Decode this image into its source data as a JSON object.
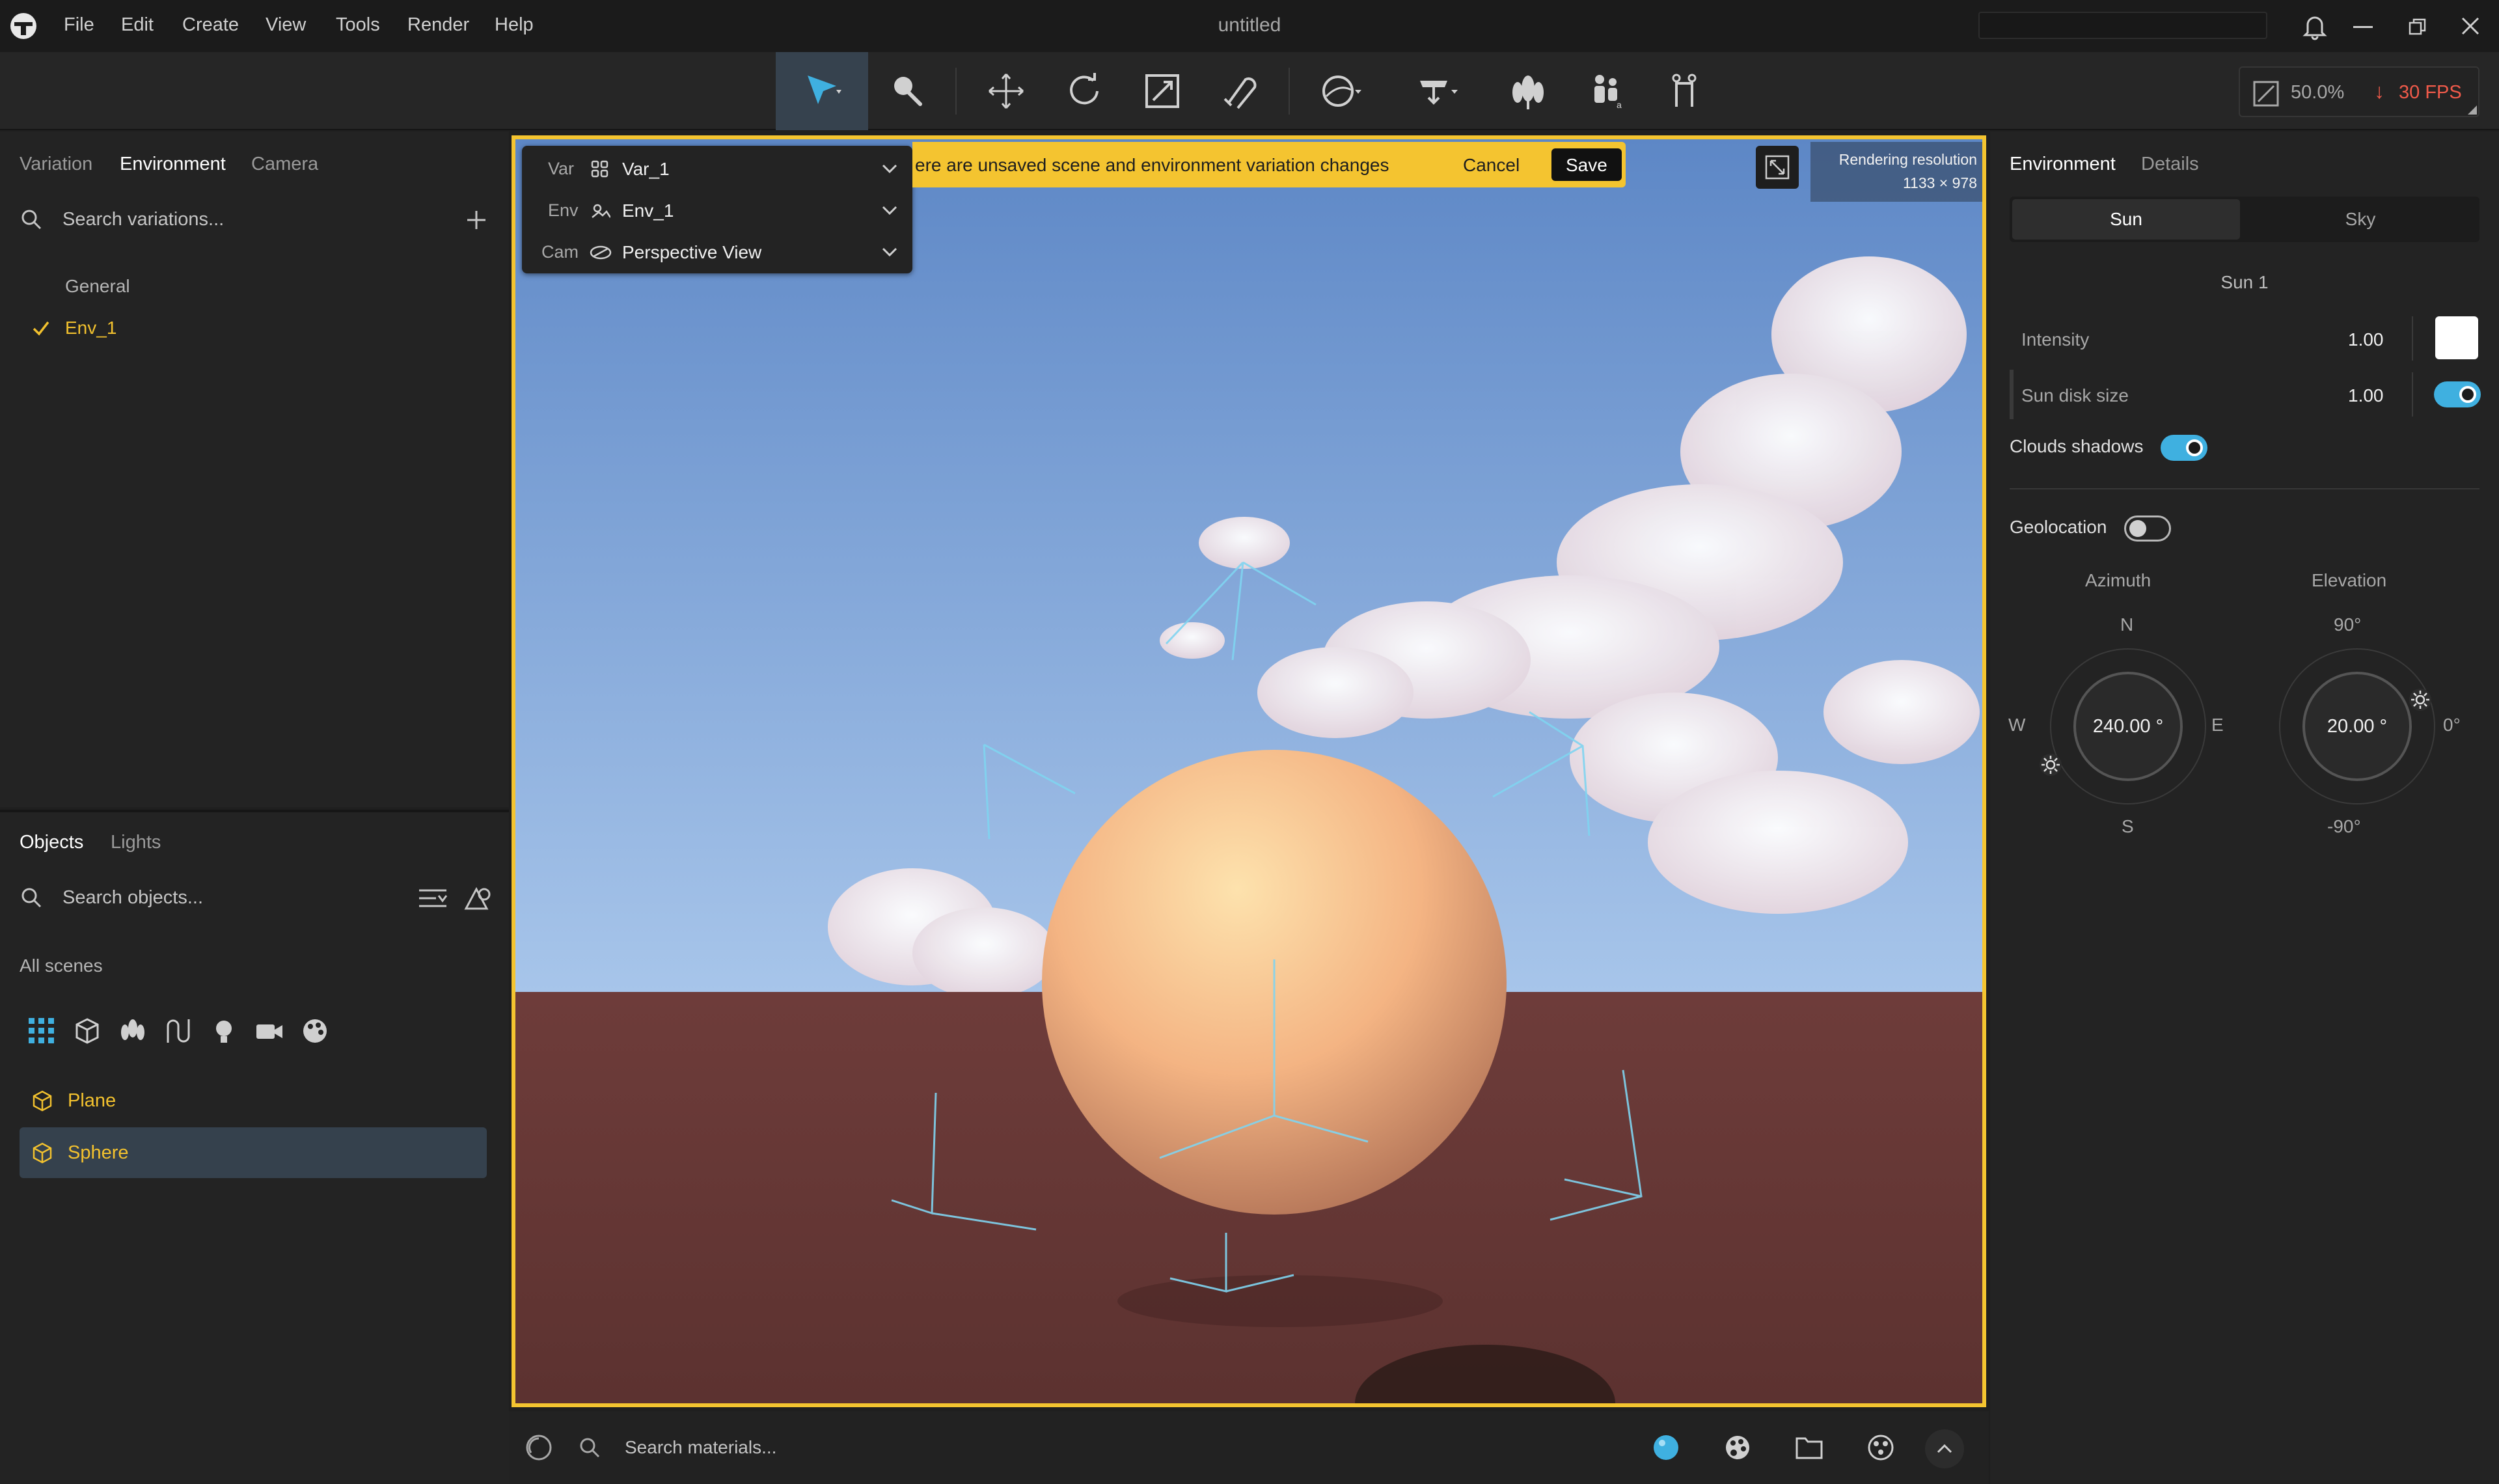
{
  "app": {
    "title": "untitled",
    "menu": [
      "File",
      "Edit",
      "Create",
      "View",
      "Tools",
      "Render",
      "Help"
    ]
  },
  "toolbar": {
    "zoom": "50.0%",
    "fps": "30 FPS",
    "tools": [
      "select-icon",
      "paint-icon",
      "move-icon",
      "rotate-icon",
      "scale-icon",
      "snap-icon",
      "shape-icon",
      "stage-icon",
      "foliage-icon",
      "people-icon",
      "rig-icon"
    ]
  },
  "left_top": {
    "tabs": [
      "Variation",
      "Environment",
      "Camera"
    ],
    "active_tab": "Environment",
    "search_placeholder": "Search variations...",
    "group_label": "General",
    "items": [
      {
        "label": "Env_1",
        "checked": true
      }
    ]
  },
  "left_bottom": {
    "tabs": [
      "Objects",
      "Lights"
    ],
    "active_tab": "Objects",
    "search_placeholder": "Search objects...",
    "scope_label": "All scenes",
    "objects": [
      {
        "label": "Plane",
        "selected": false
      },
      {
        "label": "Sphere",
        "selected": true
      }
    ]
  },
  "viewport": {
    "selectors": [
      {
        "prefix": "Var",
        "value": "Var_1"
      },
      {
        "prefix": "Env",
        "value": "Env_1"
      },
      {
        "prefix": "Cam",
        "value": "Perspective View"
      }
    ],
    "banner_text": "ere are unsaved scene and environment variation changes",
    "cancel_label": "Cancel",
    "save_label": "Save",
    "resolution_label": "Rendering resolution",
    "resolution_value": "1133 × 978",
    "sky_color": "#7a9ed2",
    "ground_color": "#6a3b38",
    "sphere_color": "#f2b884"
  },
  "bottom_bar": {
    "search_placeholder": "Search materials..."
  },
  "right_panel": {
    "tabs": [
      "Environment",
      "Details"
    ],
    "active_tab": "Environment",
    "subtabs": [
      "Sun",
      "Sky"
    ],
    "active_subtab": "Sun",
    "section_title": "Sun 1",
    "intensity_label": "Intensity",
    "intensity_value": "1.00",
    "sun_disk_label": "Sun disk size",
    "sun_disk_value": "1.00",
    "sun_disk_enabled": true,
    "clouds_label": "Clouds shadows",
    "clouds_enabled": true,
    "geolocation_label": "Geolocation",
    "geolocation_enabled": false,
    "azimuth": {
      "label": "Azimuth",
      "value": "240.00 °",
      "n": "N",
      "s": "S",
      "e": "E",
      "w": "W"
    },
    "elevation": {
      "label": "Elevation",
      "value": "20.00 °",
      "top": "90°",
      "bottom": "-90°",
      "right": "0°"
    }
  },
  "colors": {
    "accent": "#3fb0e0",
    "warning": "#f4c430",
    "object_label": "#f2c12e",
    "fps": "#f05a4a"
  }
}
